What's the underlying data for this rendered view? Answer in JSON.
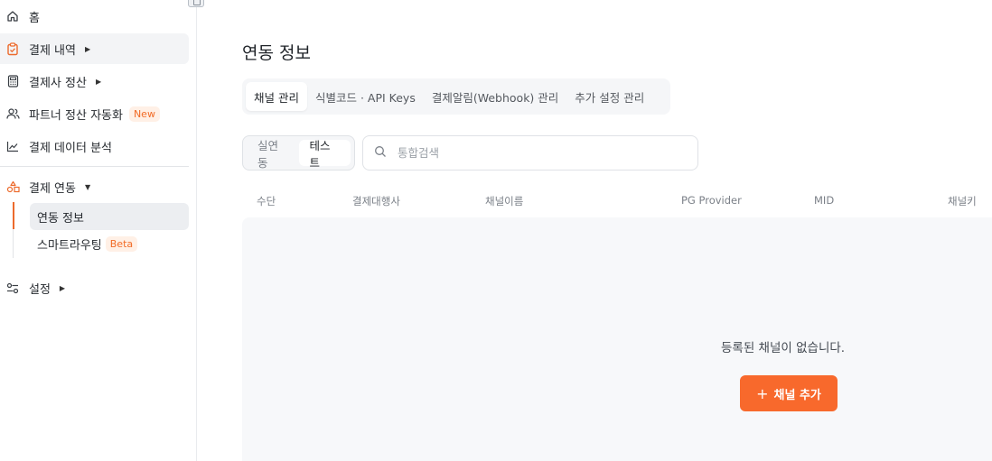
{
  "sidebar": {
    "items": [
      {
        "label": "홈",
        "icon": "home-icon"
      },
      {
        "label": "결제 내역",
        "icon": "clipboard-check-icon"
      },
      {
        "label": "결제사 정산",
        "icon": "calculator-icon"
      },
      {
        "label": "파트너 정산 자동화",
        "icon": "users-icon",
        "badge": "New"
      },
      {
        "label": "결제 데이터 분석",
        "icon": "line-chart-icon"
      },
      {
        "label": "결제 연동",
        "icon": "shapes-icon"
      },
      {
        "label": "설정",
        "icon": "sliders-icon"
      }
    ],
    "sub_items": [
      {
        "label": "연동 정보"
      },
      {
        "label": "스마트라우팅",
        "badge": "Beta"
      }
    ],
    "accent_color": "#f8692c"
  },
  "main": {
    "title": "연동 정보",
    "tabs": [
      {
        "label": "채널 관리"
      },
      {
        "label": "식별코드 · API Keys"
      },
      {
        "label": "결제알림(Webhook) 관리"
      },
      {
        "label": "추가 설정 관리"
      }
    ],
    "env_toggle": [
      {
        "label": "실연동"
      },
      {
        "label": "테스트"
      }
    ],
    "search": {
      "placeholder": "통합검색",
      "value": ""
    },
    "table": {
      "columns": [
        "수단",
        "결제대행사",
        "채널이름",
        "PG Provider",
        "MID",
        "채널키"
      ],
      "rows": []
    },
    "empty_message": "등록된 채널이 없습니다.",
    "add_button": {
      "label": "채널 추가",
      "icon": "plus-icon"
    }
  }
}
